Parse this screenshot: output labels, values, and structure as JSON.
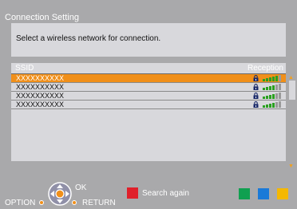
{
  "title": "Connection Setting",
  "instruction": "Select a wireless network for connection.",
  "table": {
    "header_ssid": "SSID",
    "header_reception": "Reception",
    "rows": [
      {
        "ssid": "XXXXXXXXXX",
        "locked": true,
        "signal_bars": 5,
        "selected": true
      },
      {
        "ssid": "XXXXXXXXXX",
        "locked": true,
        "signal_bars": 4,
        "selected": false
      },
      {
        "ssid": "XXXXXXXXXX",
        "locked": true,
        "signal_bars": 4,
        "selected": false
      },
      {
        "ssid": "XXXXXXXXXX",
        "locked": true,
        "signal_bars": 4,
        "selected": false
      }
    ]
  },
  "footer": {
    "ok_label": "OK",
    "option_label": "OPTION",
    "return_label": "RETURN",
    "search_label": "Search again"
  },
  "colors": {
    "selection": "#f08f1a",
    "red_button": "#e0202a",
    "green_button": "#10a050",
    "blue_button": "#1a7ad8",
    "yellow_button": "#f5b800",
    "signal_active": "#2aa020",
    "signal_inactive": "#9a9a9a"
  },
  "icons": {
    "lock": "lock-icon",
    "signal": "signal-strength-icon",
    "dpad": "dpad-icon"
  }
}
